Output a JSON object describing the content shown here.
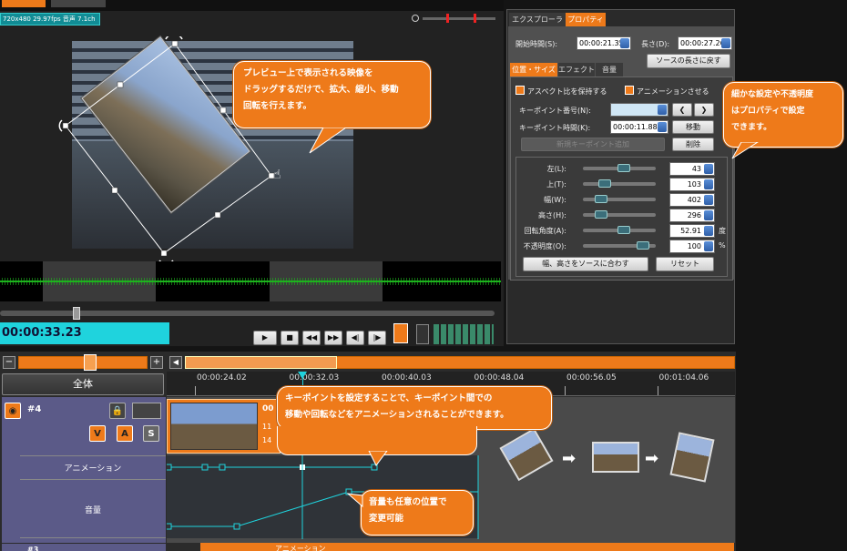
{
  "preview": {
    "info": "720x480 29.97fps 音声 7.1ch",
    "timecode": "00:00:33.23",
    "callout": "プレビュー上で表示される映像をドラッグするだけで、拡大、縮小、移動、回転を行えます。",
    "callout_lines": [
      "プレビュー上で表示される映像を",
      "ドラッグするだけで、拡大、縮小、移動",
      "回転を行えます。"
    ]
  },
  "panel": {
    "tabs": [
      "エクスプローラー",
      "プロパティ"
    ],
    "start_time_label": "開始時間(S):",
    "start_time": "00:00:21.35",
    "length_label": "長さ(D):",
    "length": "00:00:27.26",
    "reset_length_button": "ソースの長さに戻す",
    "subtabs": [
      "位置・サイズ",
      "エフェクト",
      "音量"
    ],
    "keep_aspect": "アスペクト比を保持する",
    "animate": "アニメーションさせる",
    "keypoint_number_label": "キーポイント番号(N):",
    "keypoint_number": "4",
    "keypoint_time_label": "キーポイント時間(K):",
    "keypoint_time": "00:00:11.88",
    "move_button": "移動",
    "add_keypoint_button": "新規キーポイント追加",
    "delete_button": "削除",
    "rows": [
      {
        "label": "左(L):",
        "value": "43",
        "unit": "",
        "pos": 0.58
      },
      {
        "label": "上(T):",
        "value": "103",
        "unit": "",
        "pos": 0.25
      },
      {
        "label": "幅(W):",
        "value": "402",
        "unit": "",
        "pos": 0.2
      },
      {
        "label": "高さ(H):",
        "value": "296",
        "unit": "",
        "pos": 0.2
      },
      {
        "label": "回転角度(A):",
        "value": "52.91",
        "unit": "度",
        "pos": 0.58
      },
      {
        "label": "不透明度(O):",
        "value": "100",
        "unit": "%",
        "pos": 0.9
      }
    ],
    "fit_source_button": "幅、高さをソースに合わす",
    "reset_button": "リセット",
    "callout_lines": [
      "細かな設定や不透明度",
      "はプロパティで設定",
      "できます。"
    ]
  },
  "timeline": {
    "all_button": "全体",
    "ticks": [
      "00:00:24.02",
      "00:00:32.03",
      "00:00:40.03",
      "00:00:48.04",
      "00:00:56.05",
      "00:01:04.06"
    ],
    "track_name": "#4",
    "next_track_name": "#3",
    "track_buttons": [
      "V",
      "A",
      "S"
    ],
    "animation_label": "アニメーション",
    "volume_label": "音量",
    "clip_text": [
      "00",
      "11",
      "14"
    ],
    "next_clip_text": "アニメーション",
    "callout_keypoint_lines": [
      "キーポイントを設定することで、キーポイント間での",
      "移動や回転などをアニメーションされることができます。"
    ],
    "callout_volume_lines": [
      "音量も任意の位置で",
      "変更可能"
    ]
  },
  "colors": {
    "accent": "#ee7a1a",
    "cyan": "#1fd3dd",
    "track": "#5b5a88"
  }
}
